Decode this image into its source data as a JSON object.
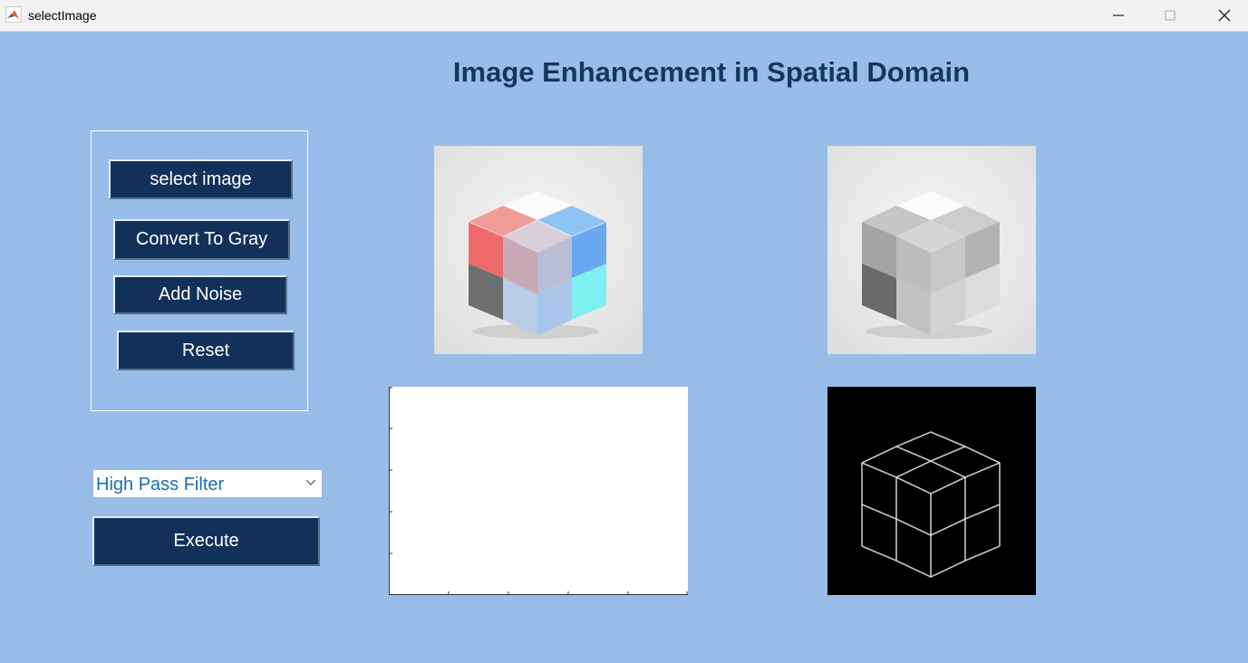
{
  "window": {
    "title": "selectImage",
    "icon": "matlab-icon"
  },
  "header": {
    "title": "Image Enhancement in Spatial Domain"
  },
  "buttons": {
    "select_image": "select image",
    "convert_gray": "Convert To Gray",
    "add_noise": "Add Noise",
    "reset": "Reset",
    "execute": "Execute"
  },
  "filter_dropdown": {
    "selected": "High Pass Filter"
  },
  "axes": {
    "x_ticks": 5,
    "y_ticks": 5
  },
  "colors": {
    "background": "#97bde8",
    "button": "#11315a",
    "title": "#15365f",
    "dropdown_text": "#1b6ea8"
  }
}
